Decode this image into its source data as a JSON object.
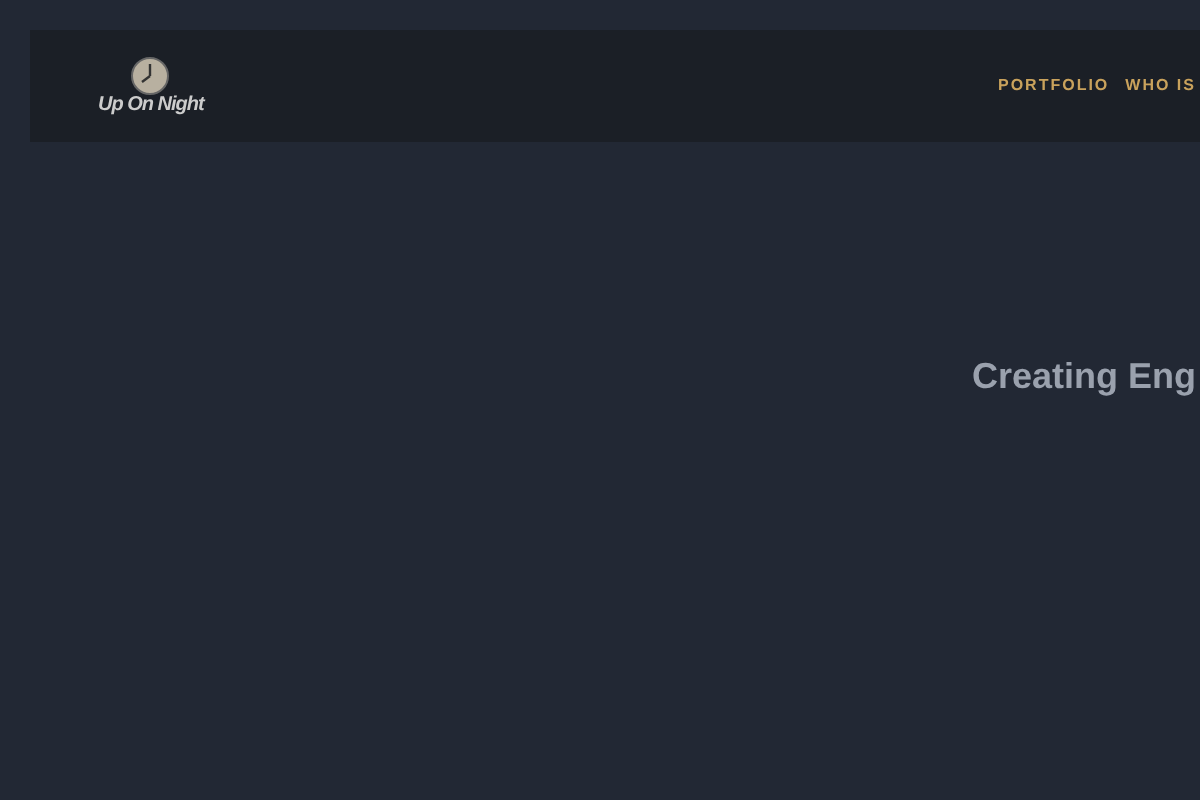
{
  "header": {
    "logo": {
      "text": "Up On Night"
    },
    "nav": [
      {
        "label": "PORTFOLIO"
      },
      {
        "label": "WHO IS"
      }
    ]
  },
  "hero": {
    "heading": "Creating Eng"
  }
}
